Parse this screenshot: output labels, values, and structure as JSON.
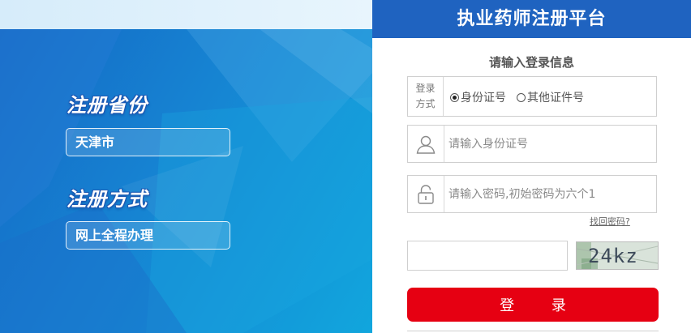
{
  "banner": {
    "province_title": "注册省份",
    "province_value": "天津市",
    "method_title": "注册方式",
    "method_value": "网上全程办理"
  },
  "login_panel": {
    "header": "执业药师注册平台",
    "subtitle": "请输入登录信息",
    "login_type": {
      "label_line1": "登录",
      "label_line2": "方式",
      "options": [
        {
          "label": "身份证号",
          "selected": true
        },
        {
          "label": "其他证件号",
          "selected": false
        }
      ]
    },
    "id_field": {
      "placeholder": "请输入身份证号",
      "icon": "user-icon"
    },
    "password_field": {
      "placeholder": "请输入密码,初始密码为六个1",
      "icon": "lock-icon"
    },
    "forgot_link": "找回密码?",
    "captcha": {
      "value": "",
      "image_text": "24kz"
    },
    "login_button": "登  录"
  },
  "colors": {
    "header_blue": "#1f63c0",
    "login_red": "#e60012",
    "banner_blue": "#1683d2"
  }
}
